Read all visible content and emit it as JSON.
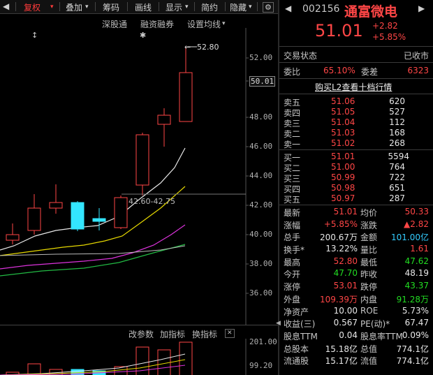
{
  "toolbar": {
    "items": [
      "复权",
      "叠加",
      "筹码",
      "画线",
      "显示",
      "简约",
      "隐藏"
    ],
    "arrow_left": "◀",
    "arrow_right": "▶",
    "dropdown": "▾"
  },
  "chart_bar": {
    "items": [
      "深股通",
      "融资融券",
      "设置均线"
    ]
  },
  "chart": {
    "y_ticks": [
      "52.00",
      "50.01",
      "48.00",
      "46.00",
      "44.00",
      "42.00",
      "40.00",
      "38.00",
      "36.00"
    ],
    "max_label": "52.80",
    "range_label": "42.60-42.75",
    "current_price_label": "50.01"
  },
  "volume_bar": {
    "items": [
      "改参数",
      "加指标",
      "换指标"
    ],
    "y_ticks": [
      "201.00",
      "99.20"
    ]
  },
  "stock": {
    "code": "002156",
    "name": "通富微电",
    "price": "51.01",
    "change": "+2.82",
    "change_pct": "+5.85%",
    "status_label": "交易状态",
    "status_value": "已收市",
    "weibi_label": "委比",
    "weibi_value": "65.10%",
    "weicha_label": "委差",
    "weicha_value": "6323",
    "l2_link": "购买L2查看十档行情"
  },
  "order_book": {
    "sells": [
      {
        "label": "卖五",
        "price": "51.06",
        "vol": "620"
      },
      {
        "label": "卖四",
        "price": "51.05",
        "vol": "527"
      },
      {
        "label": "卖三",
        "price": "51.04",
        "vol": "112"
      },
      {
        "label": "卖二",
        "price": "51.03",
        "vol": "168"
      },
      {
        "label": "卖一",
        "price": "51.02",
        "vol": "268"
      }
    ],
    "buys": [
      {
        "label": "买一",
        "price": "51.01",
        "vol": "5594"
      },
      {
        "label": "买二",
        "price": "51.00",
        "vol": "764"
      },
      {
        "label": "买三",
        "price": "50.99",
        "vol": "722"
      },
      {
        "label": "买四",
        "price": "50.98",
        "vol": "651"
      },
      {
        "label": "买五",
        "price": "50.97",
        "vol": "287"
      }
    ]
  },
  "stats": [
    {
      "l1": "最新",
      "v1": "51.01",
      "c1": "red",
      "l2": "均价",
      "v2": "50.33",
      "c2": "red"
    },
    {
      "l1": "涨幅",
      "v1": "+5.85%",
      "c1": "red",
      "l2": "涨跌",
      "v2": "▲2.82",
      "c2": "red"
    },
    {
      "l1": "总手",
      "v1": "200.67万",
      "c1": "white",
      "l2": "金额",
      "v2": "101.00亿",
      "c2": "cyan"
    },
    {
      "l1": "换手*",
      "v1": "13.22%",
      "c1": "white",
      "l2": "量比",
      "v2": "1.61",
      "c2": "red"
    },
    {
      "l1": "最高",
      "v1": "52.80",
      "c1": "red",
      "l2": "最低",
      "v2": "47.62",
      "c2": "green"
    },
    {
      "l1": "今开",
      "v1": "47.70",
      "c1": "green",
      "l2": "昨收",
      "v2": "48.19",
      "c2": "white"
    },
    {
      "l1": "涨停",
      "v1": "53.01",
      "c1": "red",
      "l2": "跌停",
      "v2": "43.37",
      "c2": "green"
    },
    {
      "l1": "外盘",
      "v1": "109.39万",
      "c1": "red",
      "l2": "内盘",
      "v2": "91.28万",
      "c2": "green"
    },
    {
      "l1": "净资产",
      "v1": "10.00",
      "c1": "white",
      "l2": "ROE",
      "v2": "5.73%",
      "c2": "white"
    },
    {
      "l1": "收益(三)",
      "v1": "0.567",
      "c1": "white",
      "l2": "PE(动)*",
      "v2": "67.47",
      "c2": "white"
    },
    {
      "l1": "股息TTM",
      "v1": "0.04",
      "c1": "white",
      "l2": "股息率TTM",
      "v2": "0.09%",
      "c2": "white"
    },
    {
      "l1": "总股本",
      "v1": "15.18亿",
      "c1": "white",
      "l2": "总值",
      "v2": "774.1亿",
      "c2": "white"
    },
    {
      "l1": "流通股",
      "v1": "15.17亿",
      "c1": "white",
      "l2": "流值",
      "v2": "774.1亿",
      "c2": "white"
    }
  ]
}
